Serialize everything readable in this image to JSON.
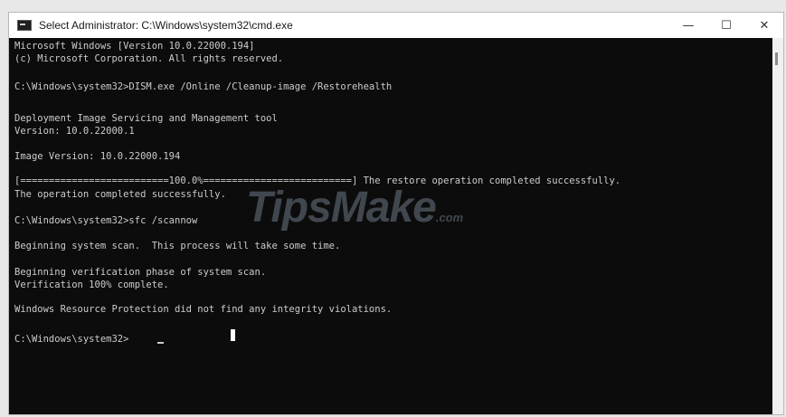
{
  "window": {
    "title": "Select Administrator: C:\\Windows\\system32\\cmd.exe",
    "controls": {
      "minimize": "—",
      "maximize": "☐",
      "close": "✕"
    }
  },
  "console": {
    "lines": [
      "Microsoft Windows [Version 10.0.22000.194]",
      "(c) Microsoft Corporation. All rights reserved.",
      "",
      "C:\\Windows\\system32>DISM.exe /Online /Cleanup-image /Restorehealth",
      "",
      "Deployment Image Servicing and Management tool",
      "Version: 10.0.22000.1",
      "",
      "Image Version: 10.0.22000.194",
      "",
      "[==========================100.0%==========================] The restore operation completed successfully.",
      "The operation completed successfully.",
      "",
      "C:\\Windows\\system32>sfc /scannow",
      "",
      "Beginning system scan.  This process will take some time.",
      "",
      "Beginning verification phase of system scan.",
      "Verification 100% complete.",
      "",
      "Windows Resource Protection did not find any integrity violations.",
      "",
      "C:\\Windows\\system32>"
    ],
    "colors": {
      "background": "#0c0c0c",
      "text": "#cccccc"
    }
  },
  "watermark": {
    "text": "TipsMake",
    "suffix": ".com"
  }
}
